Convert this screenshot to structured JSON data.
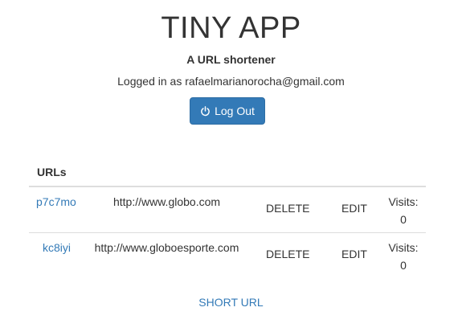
{
  "header": {
    "title": "TINY APP",
    "subtitle": "A URL shortener",
    "logged_in_text": "Logged in as rafaelmarianorocha@gmail.com",
    "logout_label": "Log Out"
  },
  "table": {
    "header": "URLs",
    "rows": [
      {
        "short": "p7c7mo",
        "long": "http://www.globo.com",
        "delete_label": "DELETE",
        "edit_label": "EDIT",
        "visits_label": "Visits:",
        "visits_count": "0"
      },
      {
        "short": "kc8iyi",
        "long": "http://www.globoesporte.com",
        "delete_label": "DELETE",
        "edit_label": "EDIT",
        "visits_label": "Visits:",
        "visits_count": "0"
      }
    ]
  },
  "footer": {
    "short_url_link": "SHORT URL"
  },
  "colors": {
    "primary": "#337ab7",
    "text": "#333333",
    "divider": "#dddddd"
  },
  "icons": {
    "logout": "power-icon"
  }
}
